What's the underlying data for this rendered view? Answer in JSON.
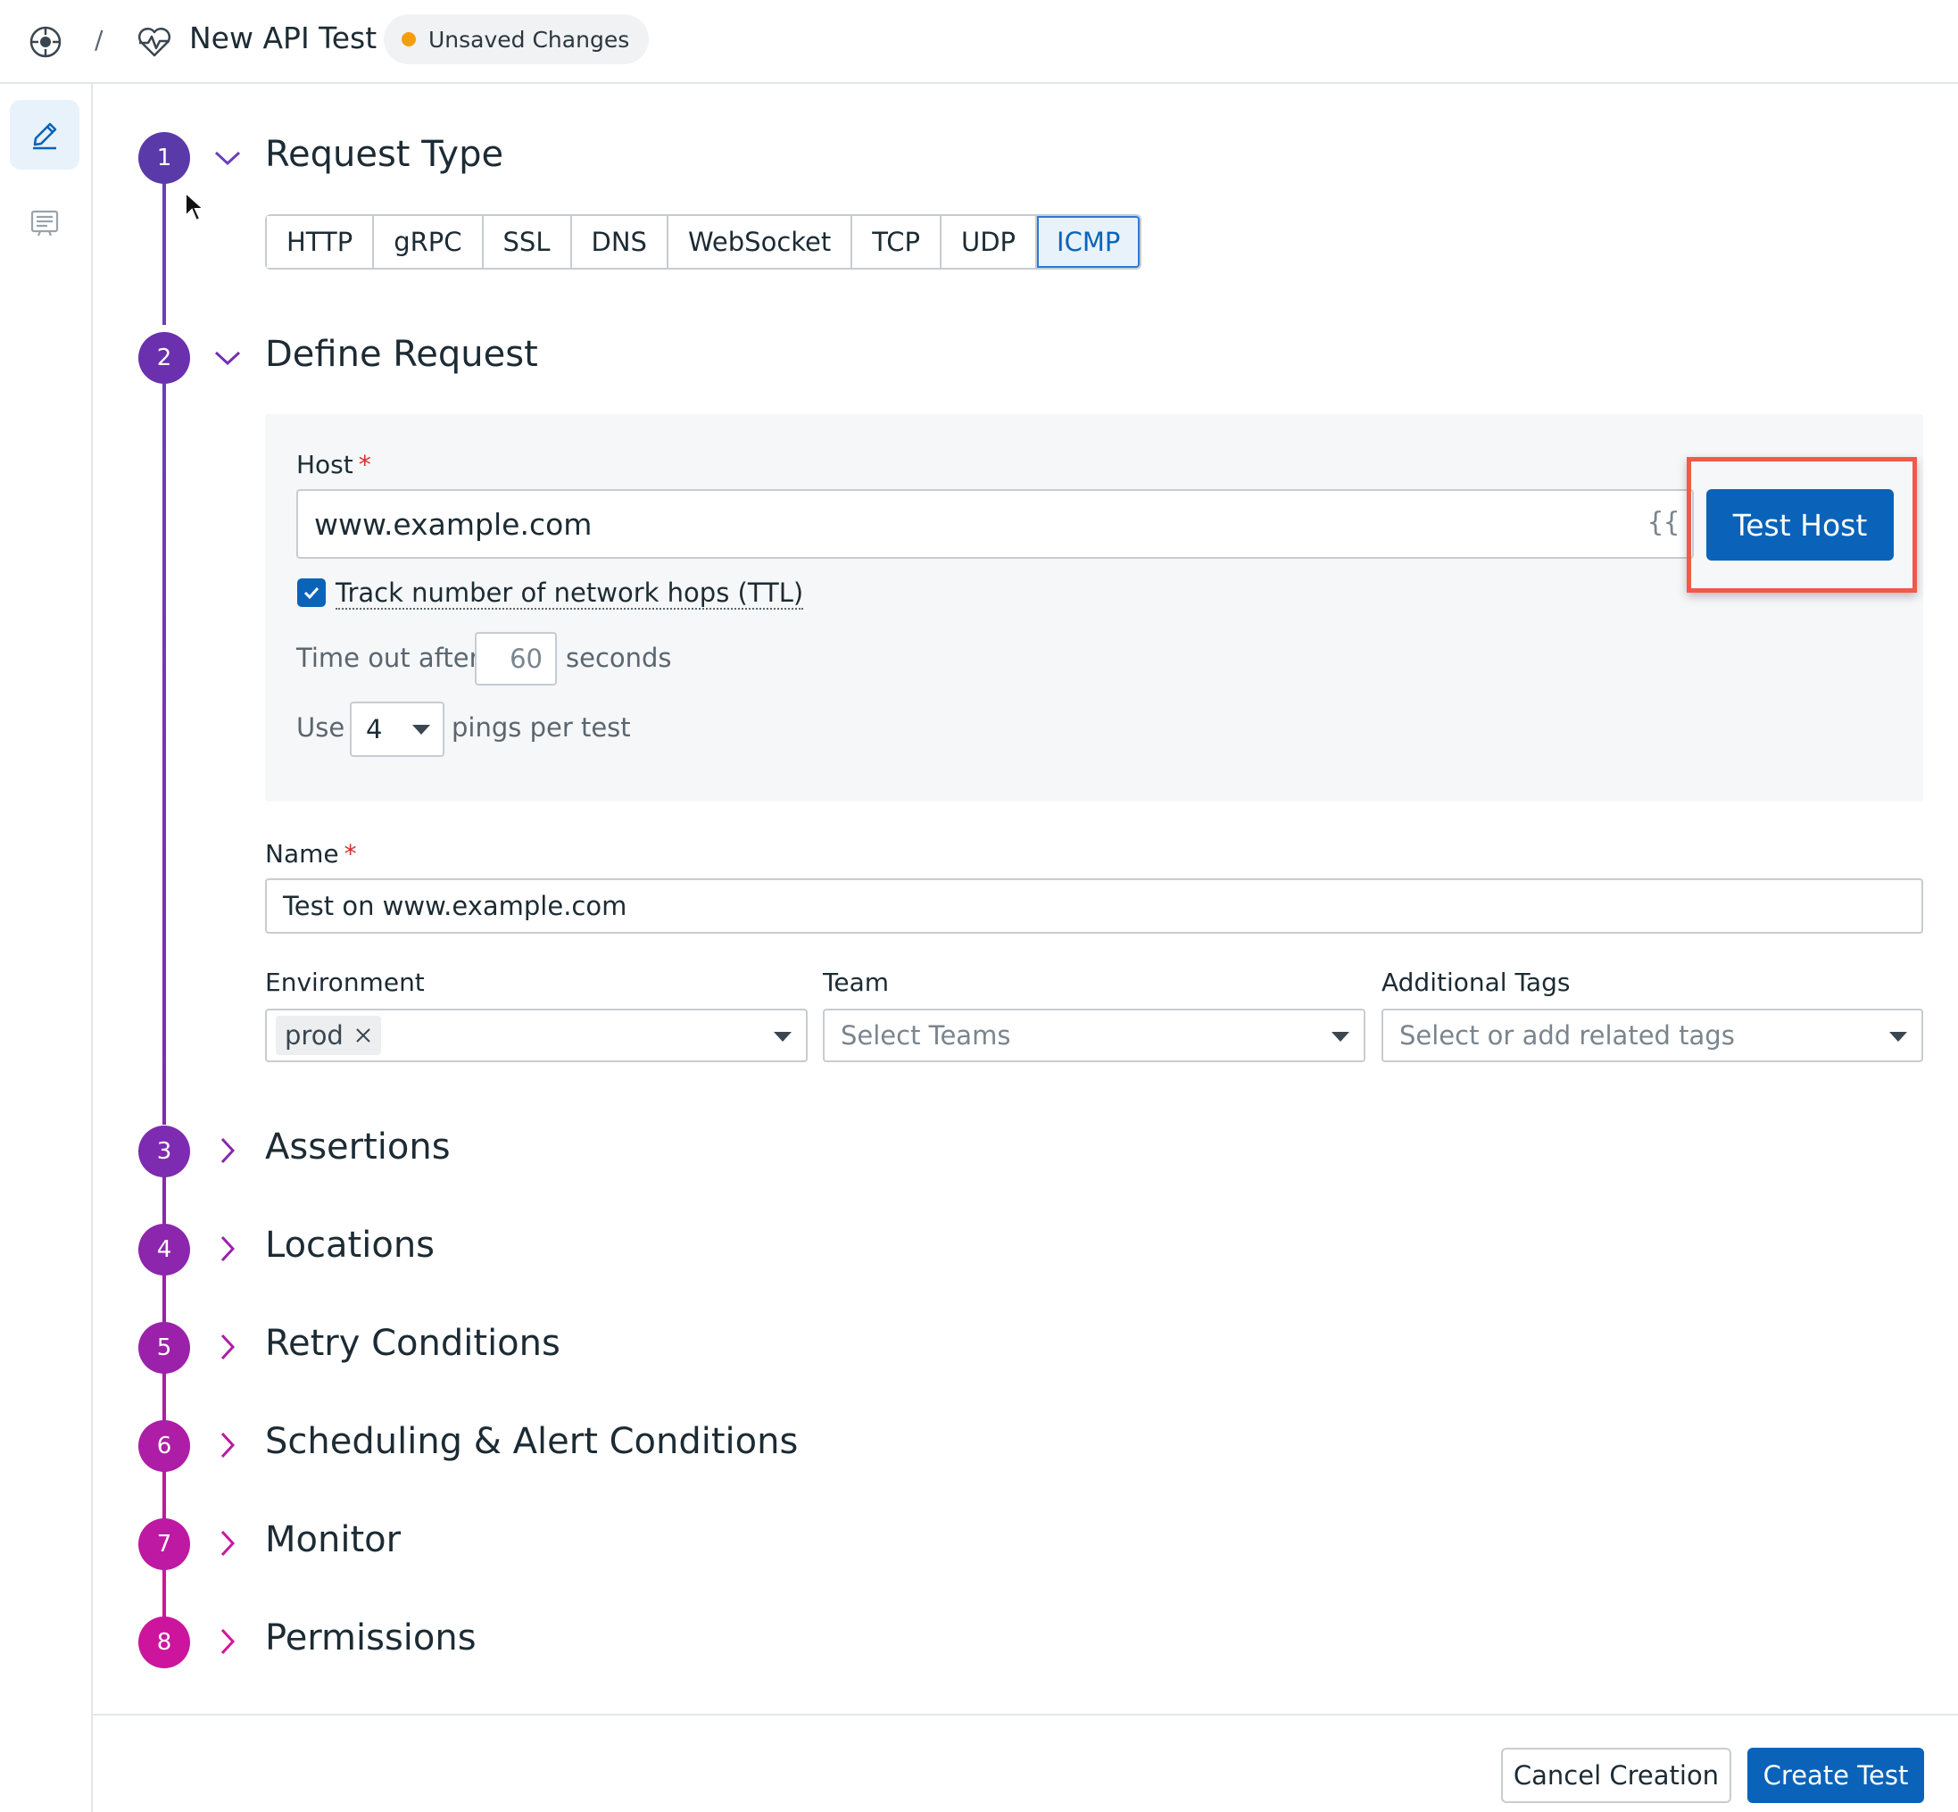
{
  "header": {
    "breadcrumb_separator": "/",
    "title": "New API Test",
    "status_badge": "Unsaved Changes",
    "status_color": "#f59e0b",
    "logo_icon": "datadog-logo-icon",
    "test_icon": "heartbeat-icon"
  },
  "rail": {
    "items": [
      {
        "icon": "pencil-icon",
        "active": true
      },
      {
        "icon": "list-icon",
        "active": false
      }
    ]
  },
  "steps": [
    {
      "number": "1",
      "title": "Request Type",
      "expanded": true
    },
    {
      "number": "2",
      "title": "Define Request",
      "expanded": true
    },
    {
      "number": "3",
      "title": "Assertions",
      "expanded": false
    },
    {
      "number": "4",
      "title": "Locations",
      "expanded": false
    },
    {
      "number": "5",
      "title": "Retry Conditions",
      "expanded": false
    },
    {
      "number": "6",
      "title": "Scheduling & Alert Conditions",
      "expanded": false
    },
    {
      "number": "7",
      "title": "Monitor",
      "expanded": false
    },
    {
      "number": "8",
      "title": "Permissions",
      "expanded": false
    }
  ],
  "request_types": [
    "HTTP",
    "gRPC",
    "SSL",
    "DNS",
    "WebSocket",
    "TCP",
    "UDP",
    "ICMP"
  ],
  "selected_request_type": "ICMP",
  "define_request": {
    "host_label": "Host",
    "required_mark": "*",
    "host_value": "www.example.com",
    "variables_icon": "{{",
    "test_host_button": "Test Host",
    "ttl_checked": true,
    "ttl_label": "Track number of network hops (TTL)",
    "timeout_prefix": "Time out after",
    "timeout_value": "60",
    "timeout_suffix": "seconds",
    "pings_prefix": "Use",
    "pings_value": "4",
    "pings_suffix": "pings per test",
    "name_label": "Name",
    "name_value": "Test on www.example.com",
    "environment_label": "Environment",
    "environment_tag": "prod",
    "team_label": "Team",
    "team_placeholder": "Select Teams",
    "tags_label": "Additional Tags",
    "tags_placeholder": "Select or add related tags"
  },
  "footer": {
    "cancel": "Cancel Creation",
    "create": "Create Test"
  },
  "colors": {
    "primary": "#0a63b8",
    "highlight_frame": "#ef5a4b",
    "step_line": "#6b3fb8"
  }
}
